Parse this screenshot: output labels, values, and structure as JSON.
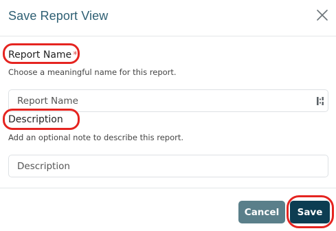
{
  "dialog": {
    "title": "Save Report View",
    "close_icon": "close-icon"
  },
  "report_name": {
    "label": "Report Name",
    "required_marker": "*",
    "helper": "Choose a meaningful name for this report.",
    "placeholder": "Report Name",
    "value": "",
    "input_icon": "password-manager-icon"
  },
  "description": {
    "label": "Description",
    "helper": "Add an optional note to describe this report.",
    "placeholder": "Description",
    "value": ""
  },
  "footer": {
    "cancel_label": "Cancel",
    "save_label": "Save"
  },
  "colors": {
    "title": "#2e5f73",
    "cancel_button": "#5a7f8a",
    "save_button": "#0d3d52",
    "required": "#d9534f",
    "annotation": "#e52420"
  }
}
